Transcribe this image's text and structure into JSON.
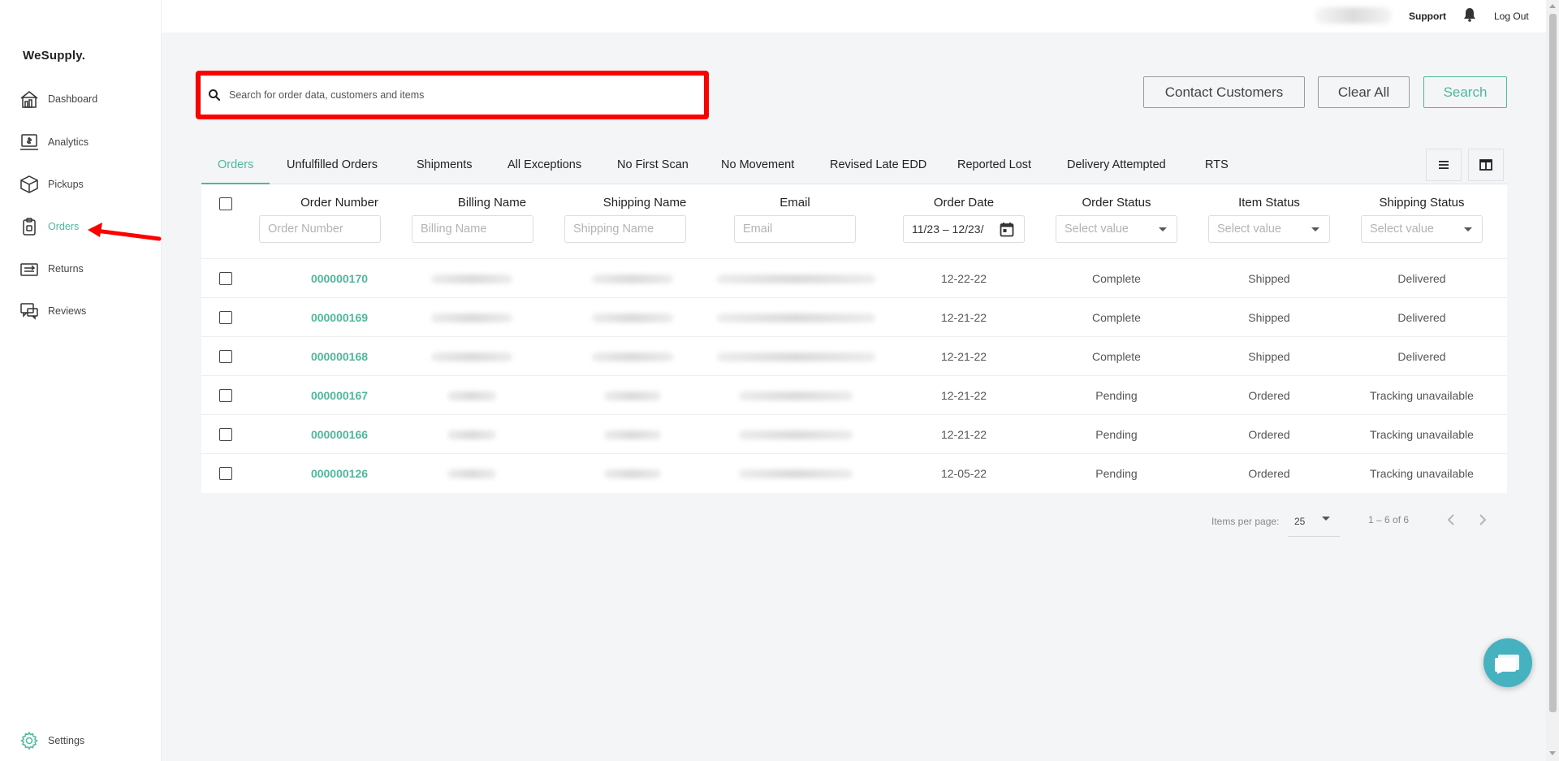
{
  "app": {
    "logo": "WeSupply."
  },
  "sidebar": {
    "items": [
      {
        "label": "Dashboard",
        "icon": "dashboard-icon"
      },
      {
        "label": "Analytics",
        "icon": "analytics-icon"
      },
      {
        "label": "Pickups",
        "icon": "box-icon"
      },
      {
        "label": "Orders",
        "icon": "clipboard-icon",
        "active": true
      },
      {
        "label": "Returns",
        "icon": "returns-icon"
      },
      {
        "label": "Reviews",
        "icon": "reviews-icon"
      }
    ],
    "settings_label": "Settings"
  },
  "topbar": {
    "support_label": "Support",
    "logout_label": "Log Out"
  },
  "search": {
    "placeholder": "Search for order data, customers and items"
  },
  "actions": {
    "contact_label": "Contact Customers",
    "clear_label": "Clear All",
    "search_label": "Search"
  },
  "tabs": [
    "Orders",
    "Unfulfilled Orders",
    "Shipments",
    "All Exceptions",
    "No First Scan",
    "No Movement",
    "Revised Late EDD",
    "Reported Lost",
    "Delivery Attempted",
    "RTS"
  ],
  "table": {
    "columns": [
      "Order Number",
      "Billing Name",
      "Shipping Name",
      "Email",
      "Order Date",
      "Order Status",
      "Item Status",
      "Shipping Status"
    ],
    "filters": {
      "order_number": "Order Number",
      "billing_name": "Billing Name",
      "shipping_name": "Shipping Name",
      "email": "Email",
      "date_range": "11/23 – 12/23/",
      "select_placeholder": "Select value"
    },
    "rows": [
      {
        "order": "000000170",
        "date": "12-22-22",
        "order_status": "Complete",
        "item_status": "Shipped",
        "shipping_status": "Delivered"
      },
      {
        "order": "000000169",
        "date": "12-21-22",
        "order_status": "Complete",
        "item_status": "Shipped",
        "shipping_status": "Delivered"
      },
      {
        "order": "000000168",
        "date": "12-21-22",
        "order_status": "Complete",
        "item_status": "Shipped",
        "shipping_status": "Delivered"
      },
      {
        "order": "000000167",
        "date": "12-21-22",
        "order_status": "Pending",
        "item_status": "Ordered",
        "shipping_status": "Tracking unavailable"
      },
      {
        "order": "000000166",
        "date": "12-21-22",
        "order_status": "Pending",
        "item_status": "Ordered",
        "shipping_status": "Tracking unavailable"
      },
      {
        "order": "000000126",
        "date": "12-05-22",
        "order_status": "Pending",
        "item_status": "Ordered",
        "shipping_status": "Tracking unavailable"
      }
    ]
  },
  "pagination": {
    "items_per_page_label": "Items per page:",
    "items_per_page": "25",
    "range": "1 – 6 of 6"
  },
  "colors": {
    "accent": "#4db89c",
    "highlight": "#ff0000",
    "chat": "#47b2bf"
  }
}
